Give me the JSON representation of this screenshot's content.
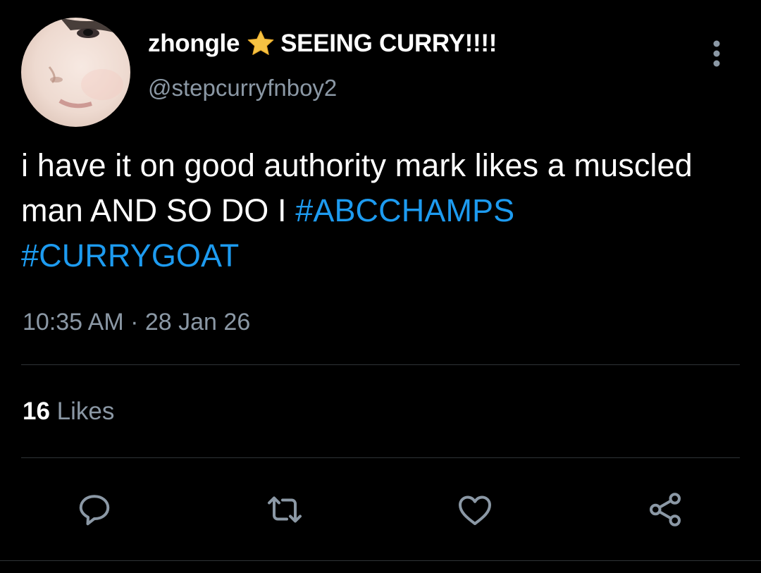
{
  "tweet": {
    "display_name": "zhongle",
    "name_suffix": "SEEING CURRY!!!!",
    "handle": "@stepcurryfnboy2",
    "text_plain": "i have it on good authority mark likes a muscled man AND SO DO I ",
    "hashtags": [
      "#ABCCHAMPS",
      "#CURRYGOAT"
    ],
    "time": "10:35 AM",
    "date": "28 Jan 26",
    "timestamp_separator": " · ",
    "likes_count": "16",
    "likes_label": "Likes"
  },
  "icons": {
    "name_badge": "star-icon",
    "more": "more-vertical-icon",
    "reply": "reply-icon",
    "retweet": "retweet-icon",
    "like": "heart-icon",
    "share": "share-icon"
  },
  "colors": {
    "background": "#000000",
    "text_primary": "#ffffff",
    "text_secondary": "#8b98a5",
    "link": "#1d9bf0",
    "divider": "#2f3336",
    "star": "#f6c343"
  }
}
